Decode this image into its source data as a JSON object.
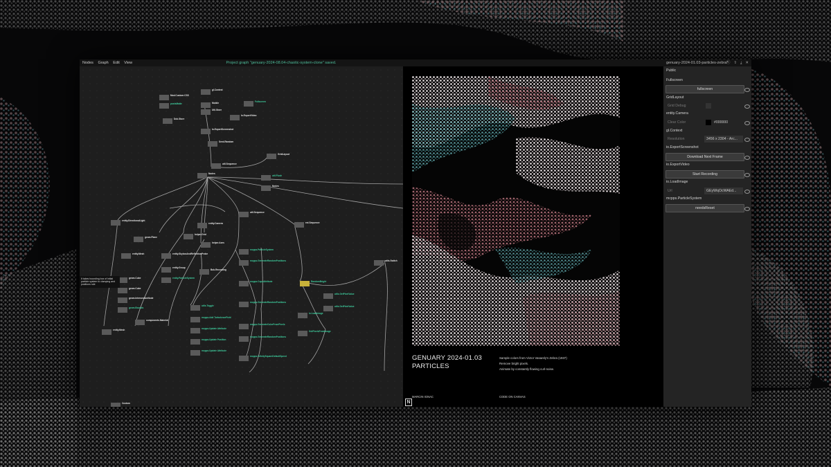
{
  "menubar": {
    "nodes": "Nodes",
    "graph": "Graph",
    "edit": "Edit",
    "view": "View"
  },
  "status_message": "Project graph \"genuary-2024-08.04-chaotic-system-clone\" saved.",
  "preview_window_title": "genuary-2024-01.03-particles-zebra*",
  "window_icons": [
    "info-icon",
    "share-icon",
    "download-icon",
    "close-icon"
  ],
  "colors": {
    "accent": "#4fbf9c",
    "panel_bg": "#242424",
    "graph_bg": "#1e1e1e",
    "highlight_node": "#c8b23a"
  },
  "graph_nodes": [
    {
      "name": "gl.Context"
    },
    {
      "name": "Mod.Custom CSS"
    },
    {
      "name": "postsMatte"
    },
    {
      "name": "Mobile"
    },
    {
      "name": "Fullscreen"
    },
    {
      "name": "Gl.Context"
    },
    {
      "name": "Dob.Store"
    },
    {
      "name": "Util.Store"
    },
    {
      "name": "Io.ExportVideo"
    },
    {
      "name": "Io.ExportScreenshot"
    },
    {
      "name": "Seed.Random"
    },
    {
      "name": "GridLayout"
    },
    {
      "name": "util.Sequence"
    },
    {
      "name": "Nodes"
    },
    {
      "name": "util.Flush"
    },
    {
      "name": "Nodes"
    },
    {
      "name": "util.Sequence"
    },
    {
      "name": "entity.DirectionalLight"
    },
    {
      "name": "entity.Camera"
    },
    {
      "name": "helper.Grid"
    },
    {
      "name": "helper.Axes"
    },
    {
      "name": "geom.Plane"
    },
    {
      "name": "ext.Sequence"
    },
    {
      "name": "entity.Mesh"
    },
    {
      "name": "entity.SkyboxAndReflectionProbe"
    },
    {
      "name": "mcpps.ParticleSystem"
    },
    {
      "name": "entity.Group"
    },
    {
      "name": "entity.ParticleSystem"
    },
    {
      "name": "Bob.Recording"
    },
    {
      "name": "mcpps.GenerateRandomPositions"
    },
    {
      "name": "geom.Cube"
    },
    {
      "name": "mcpps.CopyAttribute"
    },
    {
      "name": "RandomBright"
    },
    {
      "name": "geom.Cube"
    },
    {
      "name": "utils.GetPixelValue"
    },
    {
      "name": "geom.IntersectionNode"
    },
    {
      "name": "utils.Toggle"
    },
    {
      "name": "geom.Bounds"
    },
    {
      "name": "mcpps.GenerateRandomPositions"
    },
    {
      "name": "utils.GetPixelValue"
    },
    {
      "name": "mcpps.Add TurbulenceField"
    },
    {
      "name": "io.LoadImage"
    },
    {
      "name": "components.Material"
    },
    {
      "name": "mcpps.Update Attribute"
    },
    {
      "name": "mcpps.GenerateColorFromPixels"
    },
    {
      "name": "entity.Mesh"
    },
    {
      "name": "mcpps.Update Position"
    },
    {
      "name": "GetPixelsFromImage"
    },
    {
      "name": "mcpps.GenerateRandomPositions"
    },
    {
      "name": "mcpps.Update Attribute"
    },
    {
      "name": "mcpps.InfinitySquareDefaultSpeed"
    },
    {
      "name": "utils.Switch"
    },
    {
      "name": "Custom"
    }
  ],
  "tooltip": "It takes bounding box of initial particle system to clamping and positions rule",
  "preview": {
    "title_line1": "GENUARY 2024-01.03",
    "title_line2": "PARTICLES",
    "desc": [
      "Sample colors from Victor Vasarely's Zebra (1937)",
      "Remove bright pixels.",
      "Animate by constantly flowing curl-noise."
    ],
    "author": "MARCIN IGNAC",
    "footer_right": "CODE ON CANVAS",
    "logo": "N"
  },
  "panel": {
    "public": "Public",
    "fullscreen_section": "Fullscreen",
    "fullscreen_btn": "fullscreen",
    "gridlayout": "GridLayout",
    "grid_debug": "Grid Debug",
    "entity_camera": "entity.Camera",
    "clear_color_label": "Clear Color",
    "clear_color_value": "#000000",
    "gl_context": "gl.Context",
    "resolution_label": "Resolution",
    "resolution_value": "3456 x 2304 - Arc...",
    "export_screenshot": "io.ExportScreenshot",
    "download_btn": "Download Next Frame",
    "export_video": "io.ExportVideo",
    "start_recording_btn": "Start Recording",
    "load_image": "io.LoadImage",
    "url_label": "Url",
    "url_value": "GEyWqOcWAEd...",
    "particle_system": "mcpps.ParticleSystem",
    "needs_reset_btn": "needsReset"
  }
}
